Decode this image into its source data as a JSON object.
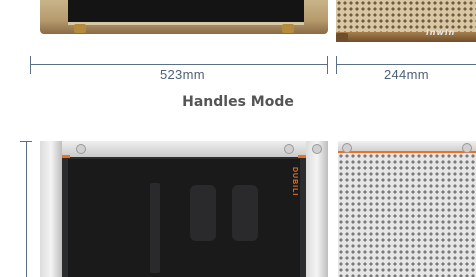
{
  "wood_mode": {
    "brand_logo": "inwin"
  },
  "dimensions": {
    "length": "523mm",
    "depth": "244mm"
  },
  "handles_mode": {
    "title": "Handles Mode",
    "side_logo": "DUBILI"
  },
  "colors": {
    "accent": "#f07020",
    "dimension_line": "#5b6f86",
    "dimension_text": "#4d6178",
    "title_text": "#555555"
  }
}
